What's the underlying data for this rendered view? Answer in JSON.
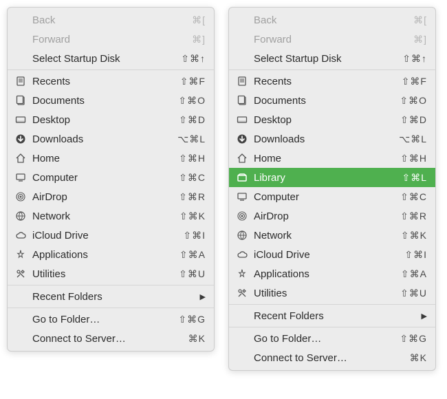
{
  "menus": [
    {
      "id": "go-menu-a",
      "groups": [
        [
          {
            "key": "back",
            "icon": null,
            "label": "Back",
            "shortcut": "⌘[",
            "disabled": true
          },
          {
            "key": "forward",
            "icon": null,
            "label": "Forward",
            "shortcut": "⌘]",
            "disabled": true
          },
          {
            "key": "startup",
            "icon": null,
            "label": "Select Startup Disk",
            "shortcut": "⇧⌘↑"
          }
        ],
        [
          {
            "key": "recents",
            "icon": "recents",
            "label": "Recents",
            "shortcut": "⇧⌘F"
          },
          {
            "key": "documents",
            "icon": "documents",
            "label": "Documents",
            "shortcut": "⇧⌘O"
          },
          {
            "key": "desktop",
            "icon": "desktop",
            "label": "Desktop",
            "shortcut": "⇧⌘D"
          },
          {
            "key": "downloads",
            "icon": "downloads",
            "label": "Downloads",
            "shortcut": "⌥⌘L"
          },
          {
            "key": "home",
            "icon": "home",
            "label": "Home",
            "shortcut": "⇧⌘H"
          },
          {
            "key": "computer",
            "icon": "computer",
            "label": "Computer",
            "shortcut": "⇧⌘C"
          },
          {
            "key": "airdrop",
            "icon": "airdrop",
            "label": "AirDrop",
            "shortcut": "⇧⌘R"
          },
          {
            "key": "network",
            "icon": "network",
            "label": "Network",
            "shortcut": "⇧⌘K"
          },
          {
            "key": "icloud",
            "icon": "icloud",
            "label": "iCloud Drive",
            "shortcut": "⇧⌘I"
          },
          {
            "key": "apps",
            "icon": "applications",
            "label": "Applications",
            "shortcut": "⇧⌘A"
          },
          {
            "key": "utilities",
            "icon": "utilities",
            "label": "Utilities",
            "shortcut": "⇧⌘U"
          }
        ],
        [
          {
            "key": "recent-folders",
            "icon": null,
            "label": "Recent Folders",
            "submenu": true
          }
        ],
        [
          {
            "key": "goto",
            "icon": null,
            "label": "Go to Folder…",
            "shortcut": "⇧⌘G"
          },
          {
            "key": "connect",
            "icon": null,
            "label": "Connect to Server…",
            "shortcut": "⌘K"
          }
        ]
      ]
    },
    {
      "id": "go-menu-b",
      "groups": [
        [
          {
            "key": "back",
            "icon": null,
            "label": "Back",
            "shortcut": "⌘[",
            "disabled": true
          },
          {
            "key": "forward",
            "icon": null,
            "label": "Forward",
            "shortcut": "⌘]",
            "disabled": true
          },
          {
            "key": "startup",
            "icon": null,
            "label": "Select Startup Disk",
            "shortcut": "⇧⌘↑"
          }
        ],
        [
          {
            "key": "recents",
            "icon": "recents",
            "label": "Recents",
            "shortcut": "⇧⌘F"
          },
          {
            "key": "documents",
            "icon": "documents",
            "label": "Documents",
            "shortcut": "⇧⌘O"
          },
          {
            "key": "desktop",
            "icon": "desktop",
            "label": "Desktop",
            "shortcut": "⇧⌘D"
          },
          {
            "key": "downloads",
            "icon": "downloads",
            "label": "Downloads",
            "shortcut": "⌥⌘L"
          },
          {
            "key": "home",
            "icon": "home",
            "label": "Home",
            "shortcut": "⇧⌘H"
          },
          {
            "key": "library",
            "icon": "library",
            "label": "Library",
            "shortcut": "⇧⌘L",
            "highlight": true
          },
          {
            "key": "computer",
            "icon": "computer",
            "label": "Computer",
            "shortcut": "⇧⌘C"
          },
          {
            "key": "airdrop",
            "icon": "airdrop",
            "label": "AirDrop",
            "shortcut": "⇧⌘R"
          },
          {
            "key": "network",
            "icon": "network",
            "label": "Network",
            "shortcut": "⇧⌘K"
          },
          {
            "key": "icloud",
            "icon": "icloud",
            "label": "iCloud Drive",
            "shortcut": "⇧⌘I"
          },
          {
            "key": "apps",
            "icon": "applications",
            "label": "Applications",
            "shortcut": "⇧⌘A"
          },
          {
            "key": "utilities",
            "icon": "utilities",
            "label": "Utilities",
            "shortcut": "⇧⌘U"
          }
        ],
        [
          {
            "key": "recent-folders",
            "icon": null,
            "label": "Recent Folders",
            "submenu": true
          }
        ],
        [
          {
            "key": "goto",
            "icon": null,
            "label": "Go to Folder…",
            "shortcut": "⇧⌘G"
          },
          {
            "key": "connect",
            "icon": null,
            "label": "Connect to Server…",
            "shortcut": "⌘K"
          }
        ]
      ]
    }
  ]
}
